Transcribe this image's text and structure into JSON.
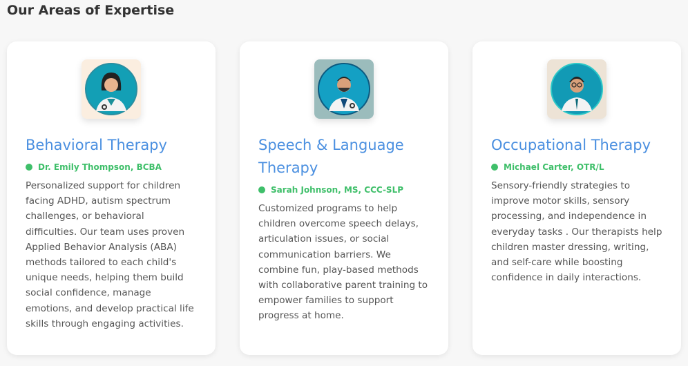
{
  "heading": "Our Areas of Expertise",
  "cards": [
    {
      "title": "Behavioral Therapy",
      "therapist": "Dr. Emily Thompson, BCBA",
      "description": "Personalized support for children facing ADHD, autism spectrum challenges, or behavioral difficulties. Our team uses proven Applied Behavior Analysis (ABA) methods tailored to each child's unique needs, helping them build social confidence, manage emotions, and develop practical life skills through engaging activities.",
      "avatar_bg": "#fbeee0",
      "icon": "female-doctor-avatar"
    },
    {
      "title": "Speech & Language Therapy",
      "therapist": "Sarah Johnson, MS, CCC-SLP",
      "description": "Customized programs to help children overcome speech delays, articulation issues, or social communication barriers. We combine fun, play-based methods with collaborative parent training to empower families to support progress at home.",
      "avatar_bg": "#9bbcbc",
      "icon": "male-doctor-avatar"
    },
    {
      "title": "Occupational Therapy",
      "therapist": "Michael Carter, OTR/L",
      "description": "Sensory-friendly strategies to improve motor skills, sensory processing, and independence in everyday tasks . Our therapists help children master dressing, writing, and self-care while boosting confidence in daily interactions.",
      "avatar_bg": "#ede3d6",
      "icon": "male-doctor-glasses-avatar"
    }
  ]
}
